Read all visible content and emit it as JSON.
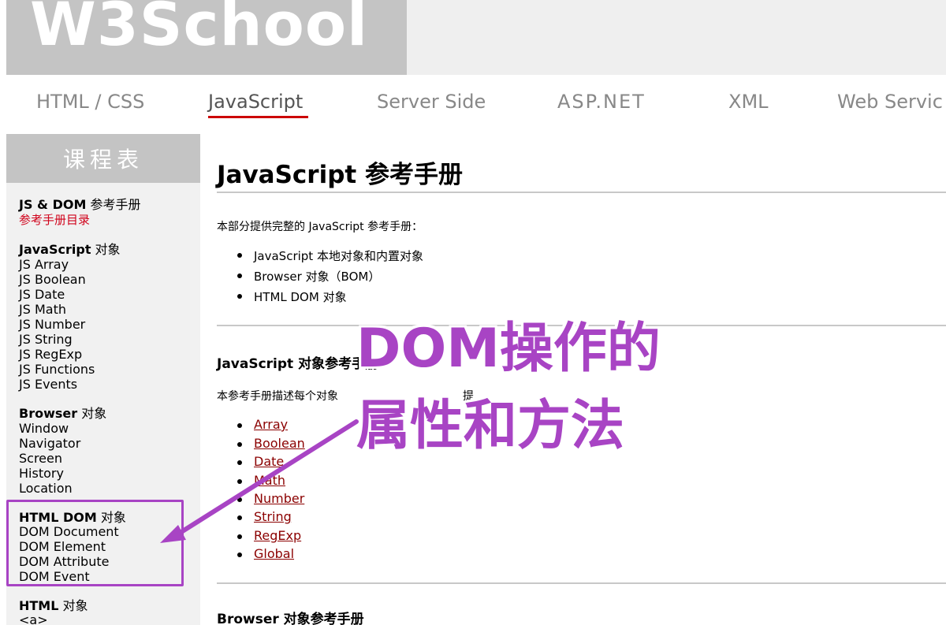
{
  "header": {
    "logo": "W3School"
  },
  "nav": {
    "items": [
      {
        "label": "HTML / CSS"
      },
      {
        "label": "JavaScript"
      },
      {
        "label": "Server Side"
      },
      {
        "label": "ASP.NET"
      },
      {
        "label": "XML"
      },
      {
        "label": "Web Servic"
      }
    ],
    "active": "JavaScript"
  },
  "sidebar": {
    "title": "课程表",
    "groups": [
      {
        "heading_bold": "JS & DOM",
        "heading_rest": " 参考手册",
        "items": [
          "参考手册目录"
        ]
      },
      {
        "heading_bold": "JavaScript",
        "heading_rest": " 对象",
        "items": [
          "JS Array",
          "JS Boolean",
          "JS Date",
          "JS Math",
          "JS Number",
          "JS String",
          "JS RegExp",
          "JS Functions",
          "JS Events"
        ]
      },
      {
        "heading_bold": "Browser",
        "heading_rest": " 对象",
        "items": [
          "Window",
          "Navigator",
          "Screen",
          "History",
          "Location"
        ]
      },
      {
        "heading_bold": "HTML DOM",
        "heading_rest": " 对象",
        "items": [
          "DOM Document",
          "DOM Element",
          "DOM Attribute",
          "DOM Event"
        ]
      },
      {
        "heading_bold": "HTML",
        "heading_rest": " 对象",
        "items": [
          "<a>"
        ]
      }
    ]
  },
  "main": {
    "title": "JavaScript 参考手册",
    "intro": "本部分提供完整的 JavaScript 参考手册：",
    "intro_items": [
      "JavaScript 本地对象和内置对象",
      "Browser 对象（BOM）",
      "HTML DOM 对象"
    ],
    "section1": {
      "heading": "JavaScript 对象参考手册",
      "desc": "本参考手册描述每个对象",
      "desc_tail": "提",
      "links": [
        "Array",
        "Boolean",
        "Date",
        "Math",
        "Number",
        "String",
        "RegExp",
        "Global"
      ]
    },
    "section2": {
      "heading": "Browser 对象参考手册"
    }
  },
  "annotation": {
    "line1": "DOM操作的",
    "line2": "属性和方法",
    "color": "#a844c4"
  }
}
